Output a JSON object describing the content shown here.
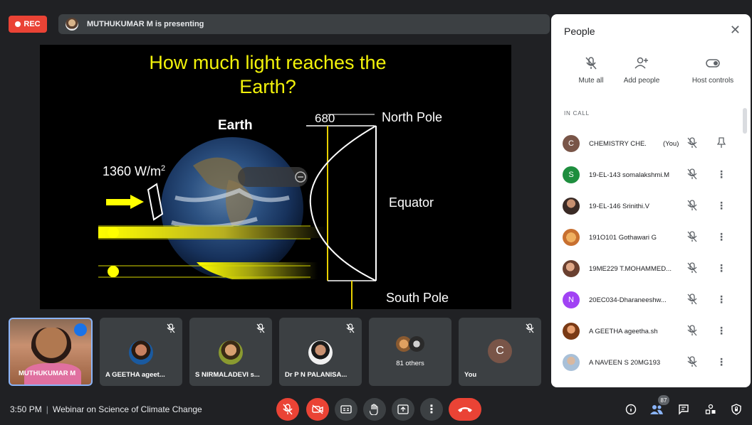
{
  "top": {
    "rec_label": "REC",
    "presenting_text": "MUTHUKUMAR M is presenting"
  },
  "slide": {
    "title_line1": "How much light reaches the",
    "title_line2": "Earth?",
    "earth_label": "Earth",
    "flux_label": "1360 W/m",
    "flux_sup": "2",
    "number_680": "680",
    "north_pole": "North Pole",
    "equator": "Equator",
    "south_pole": "South Pole"
  },
  "people": {
    "title": "People",
    "actions": {
      "mute_all": "Mute all",
      "add_people": "Add people",
      "host_controls": "Host controls"
    },
    "section_label": "IN CALL",
    "participants": [
      {
        "initial": "C",
        "name": "CHEMISTRY CHE...",
        "you": "(You)",
        "color": "#795548"
      },
      {
        "initial": "S",
        "name": "19-EL-143 somalakshmi.M",
        "you": "",
        "color": "#1e8e3e"
      },
      {
        "initial": "",
        "name": "19-EL-146 Srinithi.V",
        "you": "",
        "color": "#4a3a35"
      },
      {
        "initial": "",
        "name": "191O101 Gothawari G",
        "you": "",
        "color": "#d8893c"
      },
      {
        "initial": "",
        "name": "19ME229 T.MOHAMMED...",
        "you": "",
        "color": "#8a5a40"
      },
      {
        "initial": "N",
        "name": "20EC034-Dharaneeshw...",
        "you": "",
        "color": "#a142f4"
      },
      {
        "initial": "",
        "name": "A GEETHA ageetha.sh",
        "you": "",
        "color": "#b05a2a"
      },
      {
        "initial": "",
        "name": "A NAVEEN S 20MG193",
        "you": "",
        "color": "#9ab0c8"
      }
    ]
  },
  "tiles": [
    {
      "name": "MUTHUKUMAR M"
    },
    {
      "name": "A GEETHA ageet..."
    },
    {
      "name": "S NIRMALADEVI s..."
    },
    {
      "name": "Dr P N PALANISA..."
    },
    {
      "name": "81 others"
    },
    {
      "name": "You",
      "initial": "C"
    }
  ],
  "bottom": {
    "time": "3:50 PM",
    "separator": "|",
    "meeting_title": "Webinar on Science of Climate Change",
    "people_count": "87"
  }
}
